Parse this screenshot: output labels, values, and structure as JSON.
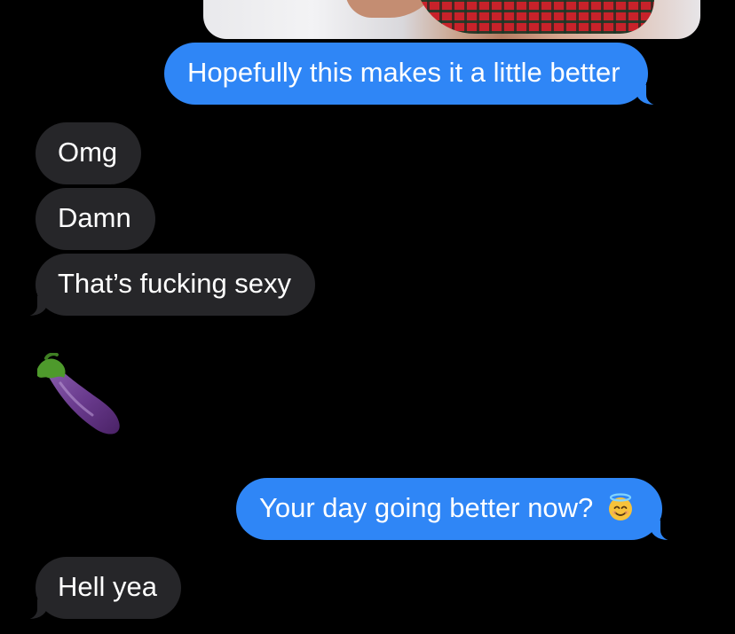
{
  "conversation": {
    "messages": [
      {
        "id": "m1",
        "direction": "sent",
        "text": "Hopefully this makes it a little better"
      },
      {
        "id": "m2",
        "direction": "received",
        "text": "Omg"
      },
      {
        "id": "m3",
        "direction": "received",
        "text": "Damn"
      },
      {
        "id": "m4",
        "direction": "received",
        "text": "That’s fucking sexy"
      },
      {
        "id": "m5",
        "direction": "received",
        "type": "emoji",
        "icon": "eggplant-icon"
      },
      {
        "id": "m6",
        "direction": "sent",
        "text": "Your day going better now?",
        "trailing_icon": "smiling-face-with-halo-icon"
      },
      {
        "id": "m7",
        "direction": "received",
        "text": "Hell yea"
      }
    ]
  },
  "colors": {
    "background": "#000000",
    "sent_bubble": "#2f86f6",
    "received_bubble": "#262629",
    "text": "#ffffff"
  }
}
